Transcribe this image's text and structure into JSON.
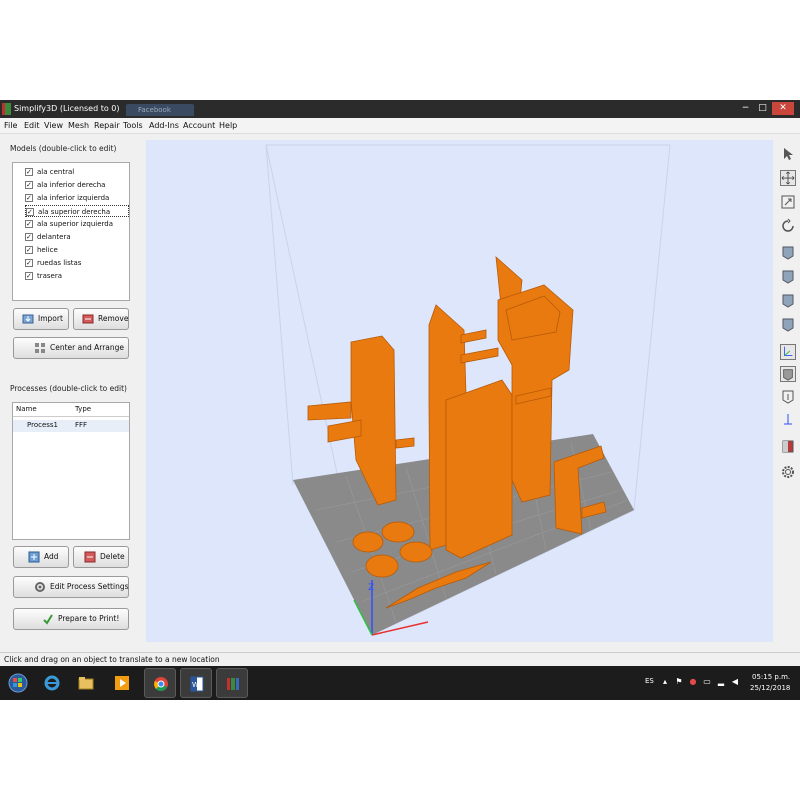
{
  "window": {
    "title": "Simplify3D (Licensed to 0)",
    "tab": "Facebook",
    "minimize": "−",
    "maximize": "□",
    "close": "✕"
  },
  "menu": [
    "File",
    "Edit",
    "View",
    "Mesh",
    "Repair",
    "Tools",
    "Add-Ins",
    "Account",
    "Help"
  ],
  "models": {
    "title": "Models (double-click to edit)",
    "items": [
      {
        "label": "ala central",
        "checked": true
      },
      {
        "label": "ala inferior derecha",
        "checked": true
      },
      {
        "label": "ala inferior izquierda",
        "checked": true
      },
      {
        "label": "ala superior derecha",
        "checked": true,
        "selected": true
      },
      {
        "label": "ala superior izquierda",
        "checked": true
      },
      {
        "label": "delantera",
        "checked": true
      },
      {
        "label": "helice",
        "checked": true
      },
      {
        "label": "ruedas listas",
        "checked": true
      },
      {
        "label": "trasera",
        "checked": true
      }
    ],
    "import_label": "Import",
    "remove_label": "Remove",
    "center_label": "Center and Arrange"
  },
  "processes": {
    "title": "Processes (double-click to edit)",
    "columns": [
      "Name",
      "Type"
    ],
    "rows": [
      {
        "name": "Process1",
        "type": "FFF"
      }
    ],
    "add_label": "Add",
    "delete_label": "Delete",
    "edit_label": "Edit Process Settings",
    "prepare_label": "Prepare to Print!"
  },
  "viewport": {
    "background": "#dde6fb",
    "bed_color": "#8a8a8a",
    "model_color": "#e97a10",
    "axis_z_label": "Z"
  },
  "toolbar_icons": [
    "select-arrow-icon",
    "move-icon",
    "scale-icon",
    "rotate-icon",
    "view-front-icon",
    "view-back-icon",
    "view-left-icon",
    "view-right-icon",
    "axes-view-icon",
    "solid-view-icon",
    "wireframe-icon",
    "bed-view-icon",
    "cross-section-icon",
    "settings-gear-icon"
  ],
  "status": {
    "text": "Click and drag on an object to translate to a new location"
  },
  "taskbar": {
    "apps": [
      "start-orb",
      "ie-icon",
      "file-explorer-icon",
      "media-player-icon",
      "chrome-icon",
      "word-icon",
      "simplify3d-icon"
    ],
    "language": "ES",
    "time": "05:15 p.m.",
    "date": "25/12/2018"
  }
}
